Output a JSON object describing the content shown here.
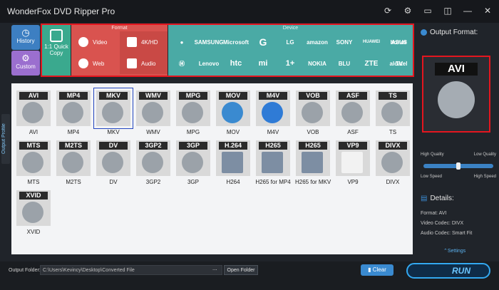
{
  "window": {
    "title": "WonderFox DVD Ripper Pro",
    "icons": [
      "refresh-icon",
      "gear-icon",
      "chat-icon",
      "cart-icon",
      "minimize-icon",
      "close-icon"
    ]
  },
  "left_tabs": {
    "history": "History",
    "custom": "Custom"
  },
  "categories": {
    "quick_copy": "1:1 Quick Copy",
    "format_header": "Format",
    "device_header": "Device",
    "video": "Video",
    "web": "Web",
    "k4": "4K/HD",
    "audio": "Audio",
    "devices_row1": [
      "",
      "SAMSUNG",
      "Microsoft",
      "G",
      "LG",
      "amazon",
      "SONY",
      "HUAWEI",
      "honor",
      "ASUS"
    ],
    "devices_row2": [
      "",
      "Lenovo",
      "htc",
      "mi",
      "1+",
      "NOKIA",
      "BLU",
      "ZTE",
      "alcatel",
      "TV"
    ]
  },
  "side_tab": "Output Profile",
  "formats": [
    {
      "label": "AVI",
      "name": "AVI"
    },
    {
      "label": "MP4",
      "name": "MP4"
    },
    {
      "label": "MKV",
      "name": "MKV",
      "selected": true
    },
    {
      "label": "WMV",
      "name": "WMV"
    },
    {
      "label": "MPG",
      "name": "MPG"
    },
    {
      "label": "MOV",
      "name": "MOV"
    },
    {
      "label": "M4V",
      "name": "M4V"
    },
    {
      "label": "VOB",
      "name": "VOB"
    },
    {
      "label": "ASF",
      "name": "ASF"
    },
    {
      "label": "TS",
      "name": "TS"
    },
    {
      "label": "MTS",
      "name": "MTS"
    },
    {
      "label": "M2TS",
      "name": "M2TS"
    },
    {
      "label": "DV",
      "name": "DV"
    },
    {
      "label": "3GP2",
      "name": "3GP2"
    },
    {
      "label": "3GP",
      "name": "3GP"
    },
    {
      "label": "H.264",
      "name": "H264"
    },
    {
      "label": "H265",
      "name": "H265 for MP4"
    },
    {
      "label": "H265",
      "name": "H265 for MKV"
    },
    {
      "label": "VP9",
      "name": "VP9"
    },
    {
      "label": "DIVX",
      "name": "DIVX"
    },
    {
      "label": "XVID",
      "name": "XVID"
    }
  ],
  "right_panel": {
    "output_format_label": "Output Format:",
    "preview_label": "AVI",
    "high_quality": "High Quality",
    "low_quality": "Low Quality",
    "low_speed": "Low Speed",
    "high_speed": "High Speed",
    "quality_level": 0.5,
    "details_label": "Details:",
    "format_line": "Format: AVI",
    "video_codec_line": "Video Codec: DIVX",
    "audio_codec_line": "Audio Codec: Smart Fit",
    "settings_label": "Settings"
  },
  "bottom": {
    "output_folder_label": "Output Folder:",
    "output_folder_value": "C:\\Users\\Kevincy\\Desktop\\Converted File",
    "browse_label": "...",
    "open_folder_label": "Open Folder",
    "clear_label": "Clear",
    "run_label": "RUN"
  }
}
